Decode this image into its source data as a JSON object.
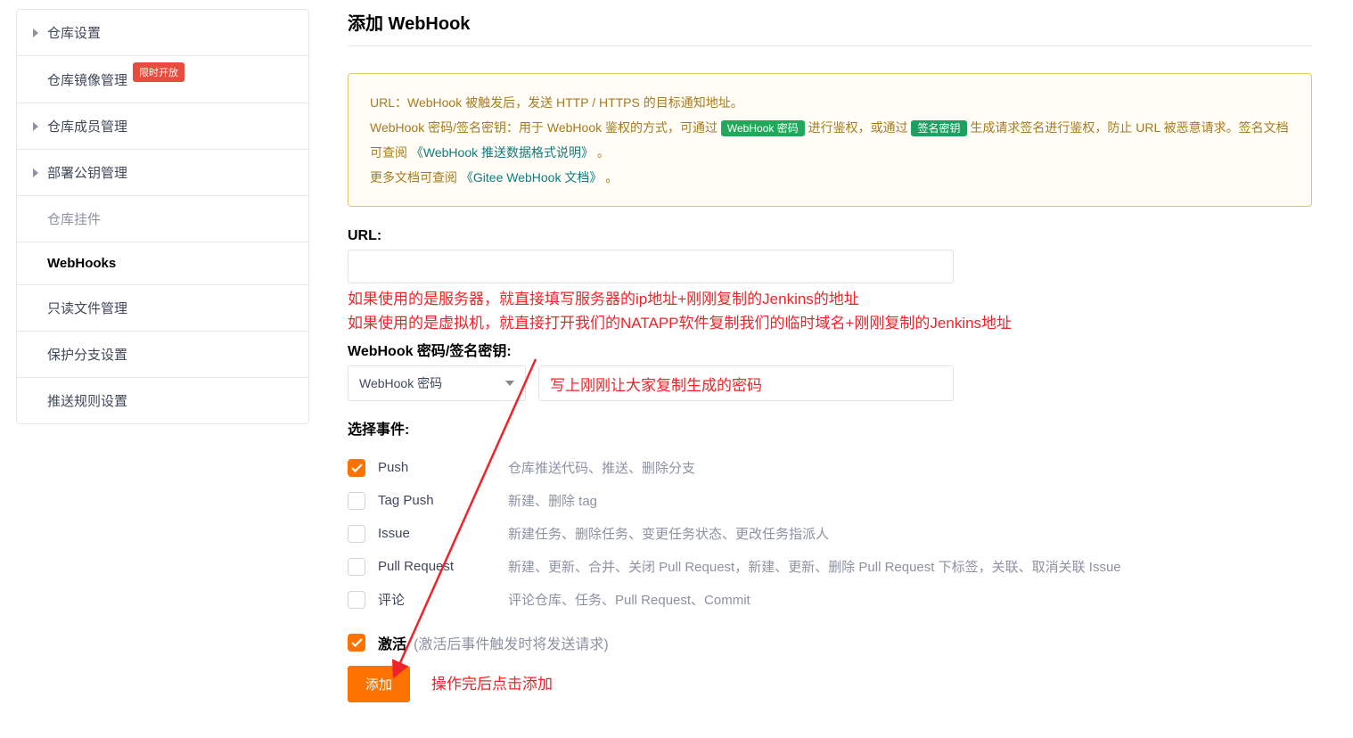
{
  "sidebar": {
    "items": [
      {
        "label": "仓库设置",
        "type": "parent"
      },
      {
        "label": "仓库镜像管理",
        "type": "sub",
        "badge": "限时开放"
      },
      {
        "label": "仓库成员管理",
        "type": "parent"
      },
      {
        "label": "部署公钥管理",
        "type": "parent"
      },
      {
        "label": "仓库挂件",
        "type": "sub",
        "muted": true
      },
      {
        "label": "WebHooks",
        "type": "sub",
        "active": true
      },
      {
        "label": "只读文件管理",
        "type": "sub"
      },
      {
        "label": "保护分支设置",
        "type": "sub"
      },
      {
        "label": "推送规则设置",
        "type": "sub"
      }
    ]
  },
  "page": {
    "title": "添加 WebHook"
  },
  "info": {
    "l1_a": "URL：WebHook 被触发后，发送 HTTP / HTTPS 的目标通知地址。",
    "l2_a": "WebHook 密码/签名密钥：用于 WebHook 鉴权的方式，可通过 ",
    "l2_pill1": "WebHook 密码",
    "l2_b": " 进行鉴权，或通过 ",
    "l2_pill2": "签名密钥",
    "l2_c": " 生成请求签名进行鉴权，防止 URL 被恶意请求。签名文档可查阅 ",
    "l2_link": "《WebHook 推送数据格式说明》",
    "l2_d": " 。",
    "l3_a": "更多文档可查阅 ",
    "l3_link": "《Gitee WebHook 文档》",
    "l3_b": " 。"
  },
  "form": {
    "url_label": "URL:",
    "url_note1": "如果使用的是服务器，就直接填写服务器的ip地址+刚刚复制的Jenkins的地址",
    "url_note2": "如果使用的是虚拟机，就直接打开我们的NATAPP软件复制我们的临时域名+刚刚复制的Jenkins地址",
    "secret_label": "WebHook 密码/签名密钥:",
    "secret_type": "WebHook 密码",
    "secret_note": "写上刚刚让大家复制生成的密码",
    "events_label": "选择事件:",
    "events": [
      {
        "name": "Push",
        "desc": "仓库推送代码、推送、删除分支",
        "checked": true
      },
      {
        "name": "Tag Push",
        "desc": "新建、删除 tag",
        "checked": false
      },
      {
        "name": "Issue",
        "desc": "新建任务、删除任务、变更任务状态、更改任务指派人",
        "checked": false
      },
      {
        "name": "Pull Request",
        "desc": "新建、更新、合并、关闭 Pull Request，新建、更新、删除 Pull Request 下标签，关联、取消关联 Issue",
        "checked": false
      },
      {
        "name": "评论",
        "desc": "评论仓库、任务、Pull Request、Commit",
        "checked": false
      }
    ],
    "activate_label": "激活",
    "activate_hint": "(激活后事件触发时将发送请求)",
    "submit": "添加",
    "submit_note": "操作完后点击添加"
  }
}
